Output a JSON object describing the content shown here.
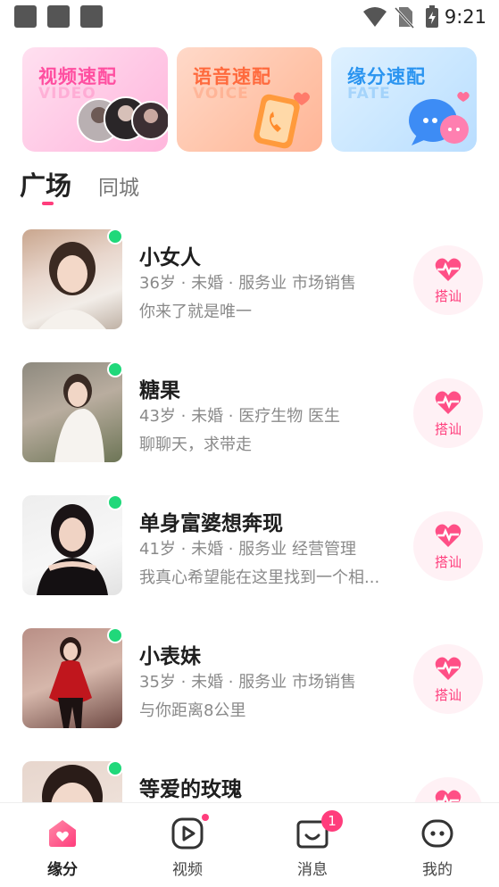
{
  "status_bar": {
    "time": "9:21"
  },
  "match_cards": [
    {
      "title": "视频速配",
      "subtitle": "VIDEO"
    },
    {
      "title": "语音速配",
      "subtitle": "VOICE"
    },
    {
      "title": "缘分速配",
      "subtitle": "FATE"
    }
  ],
  "tabs": [
    {
      "label": "广场",
      "active": true
    },
    {
      "label": "同城",
      "active": false
    }
  ],
  "users": [
    {
      "name": "小女人",
      "meta": "36岁 · 未婚 · 服务业 市场销售",
      "bio": "你来了就是唯一",
      "action": "搭讪",
      "online": true
    },
    {
      "name": "糖果",
      "meta": "43岁 · 未婚 · 医疗生物 医生",
      "bio": "聊聊天，求带走",
      "action": "搭讪",
      "online": true
    },
    {
      "name": "单身富婆想奔现",
      "meta": "41岁 · 未婚 · 服务业 经营管理",
      "bio": "我真心希望能在这里找到一个相...",
      "action": "搭讪",
      "online": true
    },
    {
      "name": "小表妹",
      "meta": "35岁 · 未婚 · 服务业 市场销售",
      "bio": "与你距离8公里",
      "action": "搭讪",
      "online": true
    },
    {
      "name": "等爱的玫瑰",
      "meta": "",
      "bio": "",
      "action": "搭讪",
      "online": true
    }
  ],
  "bottom_nav": {
    "items": [
      {
        "label": "缘分",
        "icon": "home-heart-icon",
        "active": true
      },
      {
        "label": "视频",
        "icon": "play-icon",
        "active": false,
        "dot": true
      },
      {
        "label": "消息",
        "icon": "message-icon",
        "active": false,
        "badge": "1"
      },
      {
        "label": "我的",
        "icon": "profile-face-icon",
        "active": false
      }
    ]
  },
  "colors": {
    "accent": "#ff3d7c",
    "online": "#20d87a"
  }
}
